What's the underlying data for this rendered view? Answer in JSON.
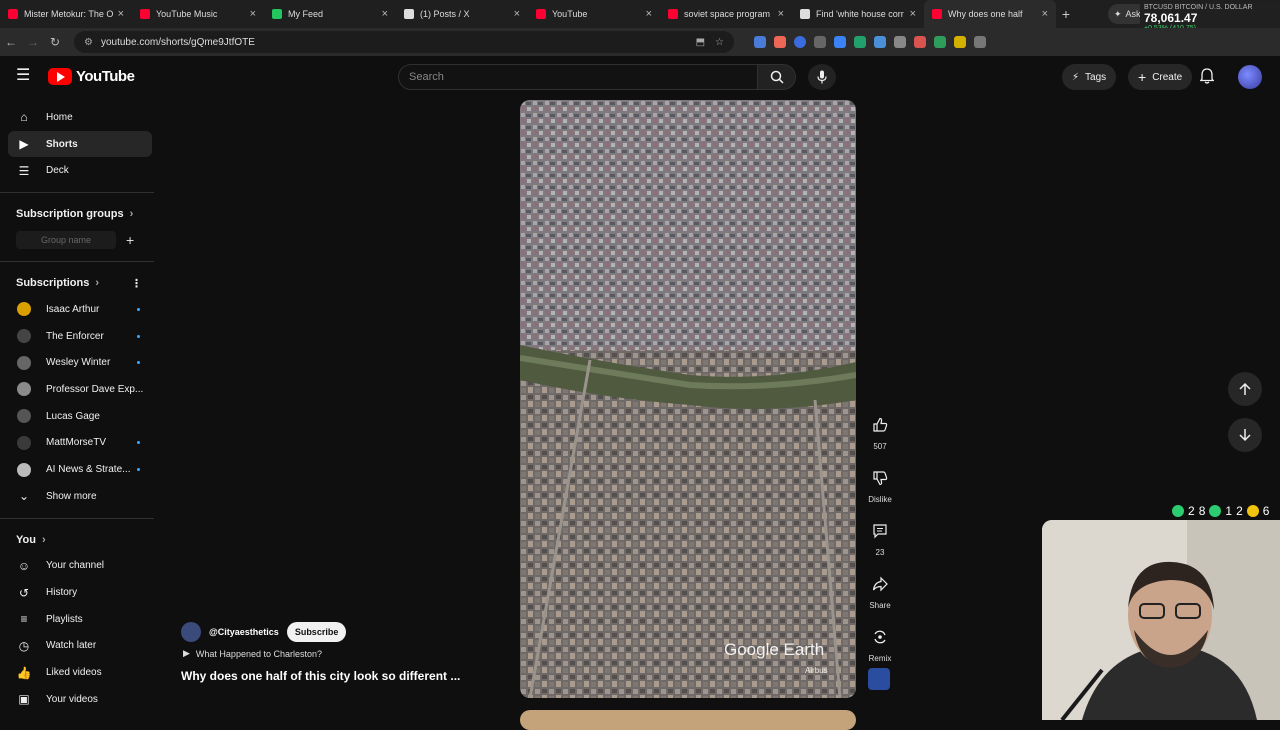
{
  "browser": {
    "tabs": [
      {
        "title": "Mister Metokur: The O",
        "color": "#ff0033"
      },
      {
        "title": "YouTube Music",
        "color": "#ff0033"
      },
      {
        "title": "My Feed",
        "color": "#22c55e"
      },
      {
        "title": "(1) Posts / X",
        "color": "#ffffff"
      },
      {
        "title": "YouTube",
        "color": "#ff0033"
      },
      {
        "title": "soviet space program",
        "color": "#ff0033"
      },
      {
        "title": "Find 'white house corr",
        "color": "#ffffff"
      },
      {
        "title": "Why does one half",
        "color": "#ff0033"
      }
    ],
    "ask_label": "Ask",
    "url": "youtube.com/shorts/gQme9JtfOTE",
    "ticker": {
      "symbol": "BTCUSD",
      "name": "BITCOIN / U.S. DOLLAR",
      "price": "78,061.47",
      "change": "+0.53% (410.75)"
    }
  },
  "header": {
    "logo_text": "YouTube",
    "search_placeholder": "Search",
    "tags_label": "Tags",
    "create_label": "Create"
  },
  "sidebar": {
    "main": [
      {
        "label": "Home",
        "icon": "home-icon"
      },
      {
        "label": "Shorts",
        "icon": "shorts-icon"
      },
      {
        "label": "Deck",
        "icon": "deck-icon"
      }
    ],
    "subscription_groups_label": "Subscription groups",
    "group_name_placeholder": "Group name",
    "subscriptions_label": "Subscriptions",
    "subscriptions": [
      {
        "name": "Isaac Arthur",
        "color": "#d9a000"
      },
      {
        "name": "The Enforcer",
        "color": "#444444"
      },
      {
        "name": "Wesley Winter",
        "color": "#666666"
      },
      {
        "name": "Professor Dave Exp...",
        "color": "#8a8a8a"
      },
      {
        "name": "Lucas Gage",
        "color": "#555555"
      },
      {
        "name": "MattMorseTV",
        "color": "#3a3a3a"
      },
      {
        "name": "AI News & Strate...",
        "color": "#bbbbbb"
      }
    ],
    "show_more_label": "Show more",
    "you_label": "You",
    "you_items": [
      {
        "label": "Your channel",
        "icon": "channel-icon"
      },
      {
        "label": "History",
        "icon": "history-icon"
      },
      {
        "label": "Playlists",
        "icon": "playlists-icon"
      },
      {
        "label": "Watch later",
        "icon": "watch-later-icon"
      },
      {
        "label": "Liked videos",
        "icon": "liked-icon"
      },
      {
        "label": "Your videos",
        "icon": "your-videos-icon"
      }
    ]
  },
  "short": {
    "channel": "@Cityaesthetics",
    "subscribe_label": "Subscribe",
    "related": "What Happened to Charleston?",
    "title": "Why does one half of this city look so different ...",
    "watermark": "Google Earth",
    "watermark_sub": "Airbus",
    "likes": "507",
    "dislike_label": "Dislike",
    "comments": "23",
    "share_label": "Share",
    "remix_label": "Remix"
  },
  "overlay": {
    "counts": [
      "2",
      "8",
      "1",
      "2",
      "6"
    ]
  }
}
